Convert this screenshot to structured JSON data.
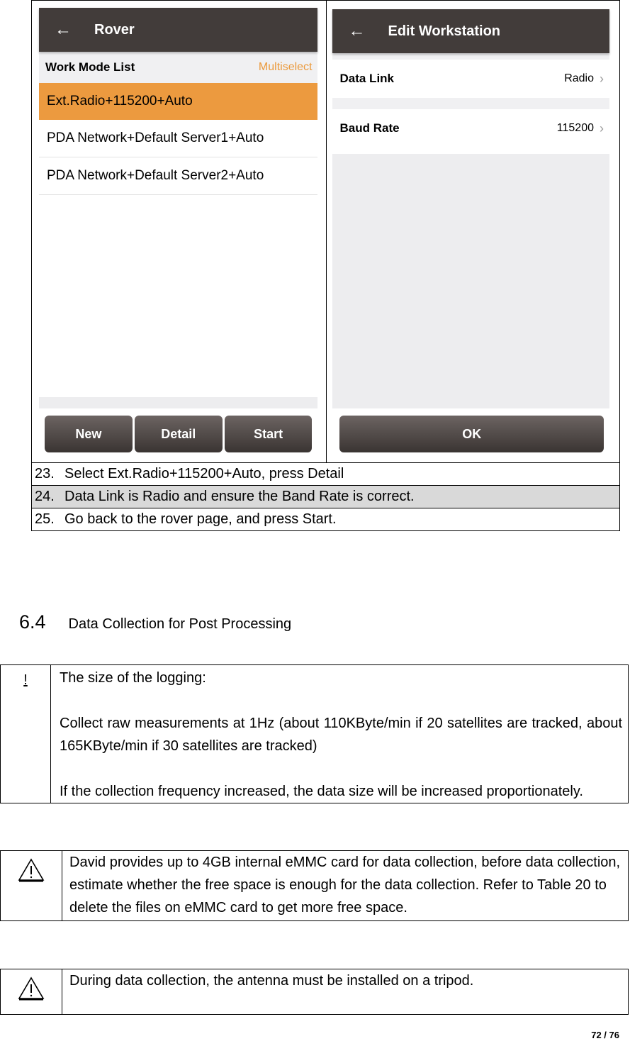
{
  "screenshots": {
    "rover": {
      "title": "Rover",
      "list_header": "Work Mode List",
      "list_action": "Multiselect",
      "items": [
        {
          "label": "Ext.Radio+115200+Auto",
          "selected": true
        },
        {
          "label": "PDA Network+Default Server1+Auto",
          "selected": false
        },
        {
          "label": "PDA Network+Default Server2+Auto",
          "selected": false
        }
      ],
      "buttons": [
        "New",
        "Detail",
        "Start"
      ]
    },
    "edit_workstation": {
      "title": "Edit Workstation",
      "rows": [
        {
          "label": "Data Link",
          "value": "Radio"
        },
        {
          "label": "Baud Rate",
          "value": "115200"
        }
      ],
      "ok_label": "OK"
    },
    "colors": {
      "appbar": "#423c3a",
      "accent": "#ec9a3f"
    }
  },
  "steps": [
    {
      "num": "23.",
      "text": "Select Ext.Radio+115200+Auto, press Detail"
    },
    {
      "num": "24.",
      "text": "Data Link is Radio and ensure the Band Rate is correct."
    },
    {
      "num": "25.",
      "text": "Go back to the rover page, and press Start."
    }
  ],
  "section": {
    "number": "6.4",
    "title": "Data Collection for Post Processing"
  },
  "notes": {
    "logging": {
      "icon": "!",
      "heading": "The size of the logging:",
      "para1": "Collect raw measurements at 1Hz (about 110KByte/min if 20 satellites are tracked, about 165KByte/min if 30 satellites are tracked)",
      "para2": "If the collection frequency increased, the data size will be increased proportionately."
    },
    "storage_warning": "David provides up to 4GB internal eMMC card for data collection, before data collection, estimate whether the free space is enough for the data collection. Refer to Table 20 to delete the files on eMMC card to get more free space.",
    "tripod_warning": "During data collection, the antenna must be installed on a tripod."
  },
  "page_number": "72 / 76"
}
